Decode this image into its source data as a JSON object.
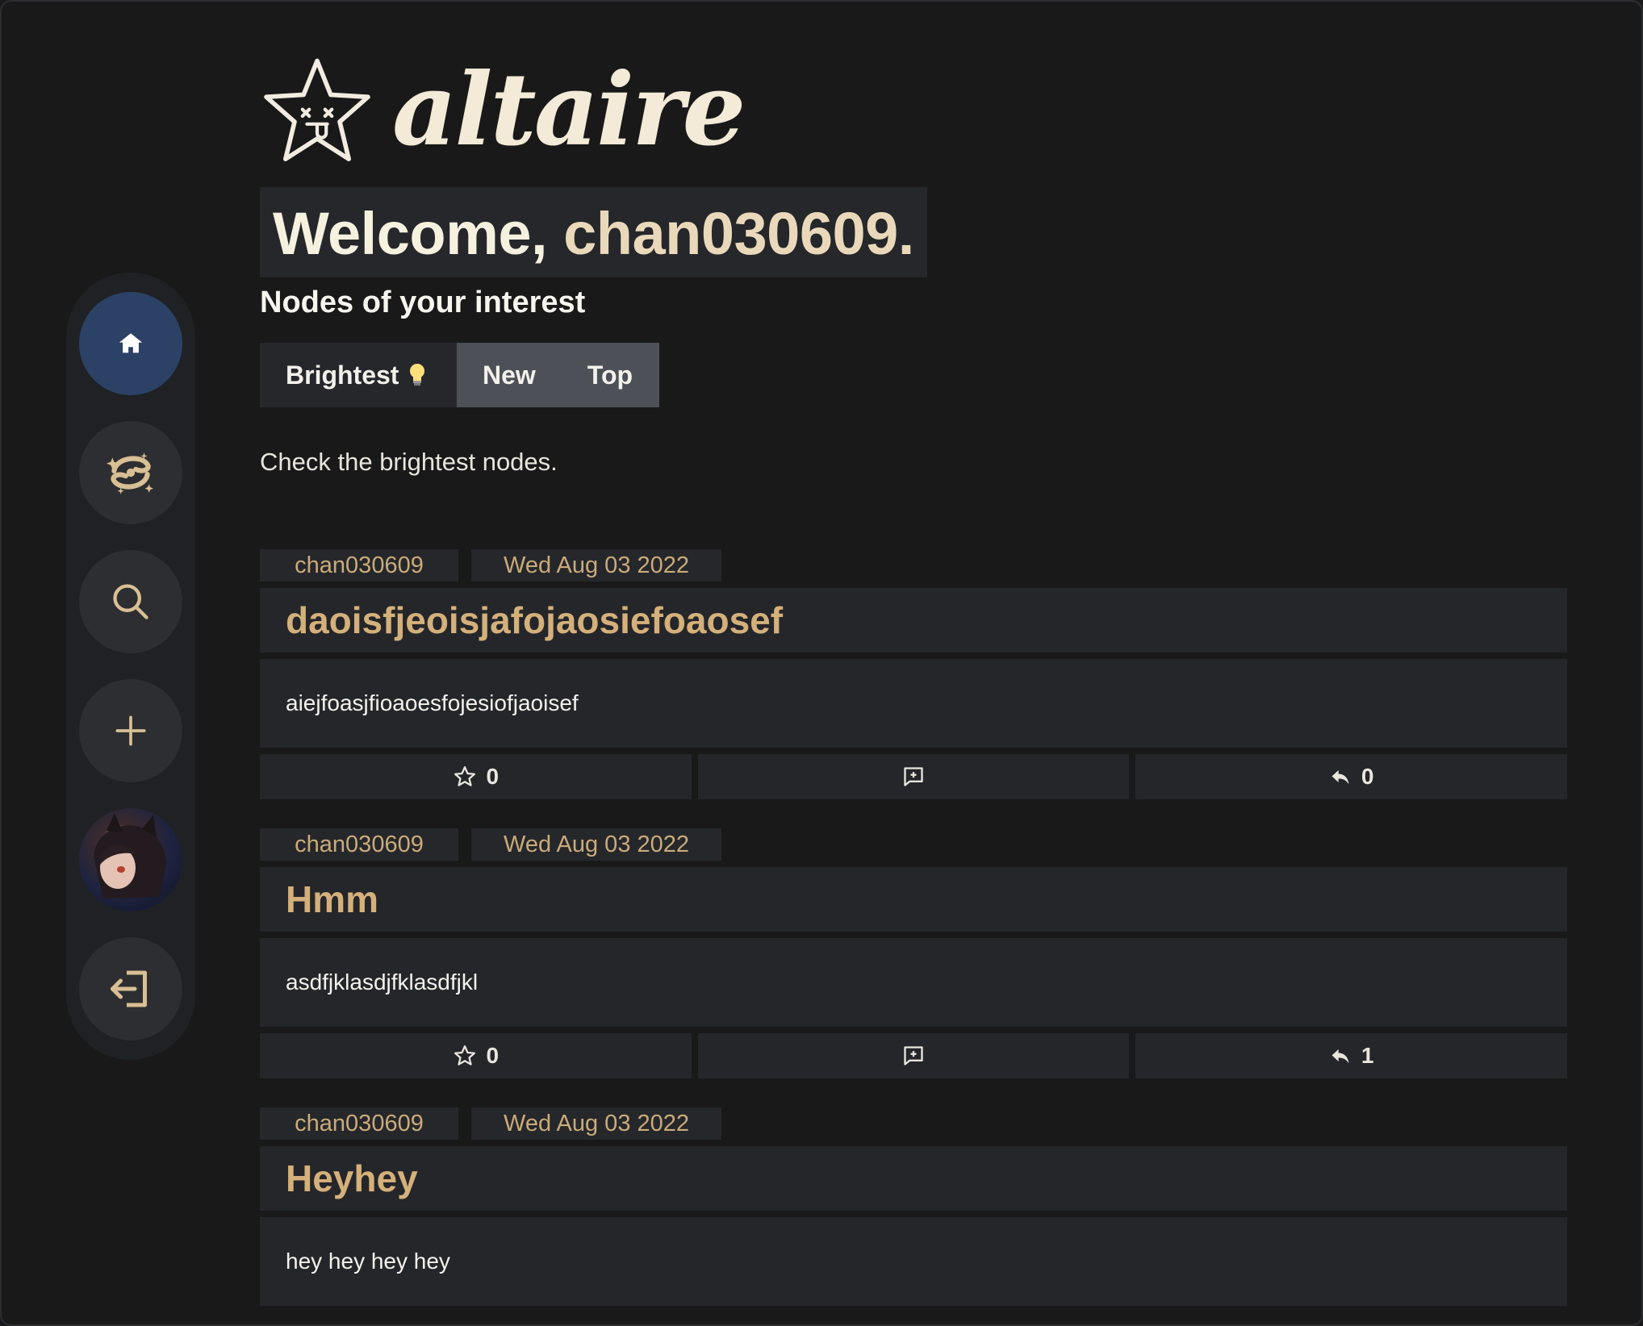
{
  "brand": {
    "name": "altaire"
  },
  "welcome": {
    "prefix": "Welcome, ",
    "username": "chan030609."
  },
  "section_title": "Nodes of your interest",
  "tabs": [
    {
      "label": "Brightest",
      "icon": "lightbulb-icon"
    },
    {
      "label": "New"
    },
    {
      "label": "Top"
    }
  ],
  "hint": "Check the brightest nodes.",
  "sidebar": {
    "items": [
      {
        "icon": "home-icon",
        "active": true
      },
      {
        "icon": "galaxy-icon"
      },
      {
        "icon": "search-icon"
      },
      {
        "icon": "plus-icon"
      },
      {
        "icon": "avatar"
      },
      {
        "icon": "logout-icon"
      }
    ]
  },
  "posts": [
    {
      "author": "chan030609",
      "date": "Wed Aug 03 2022",
      "title": "daoisfjeoisjafojaosiefoaosef",
      "body": "aiejfoasjfioaoesfojesiofjaoisef",
      "stars": "0",
      "replies": "0"
    },
    {
      "author": "chan030609",
      "date": "Wed Aug 03 2022",
      "title": "Hmm",
      "body": "asdfjklasdjfklasdfjkl",
      "stars": "0",
      "replies": "1"
    },
    {
      "author": "chan030609",
      "date": "Wed Aug 03 2022",
      "title": "Heyhey",
      "body": "hey hey hey hey"
    }
  ],
  "colors": {
    "background": "#19191a",
    "panel": "#25262a",
    "accent_gold": "#d4b07a",
    "active_nav": "#2b4266"
  }
}
